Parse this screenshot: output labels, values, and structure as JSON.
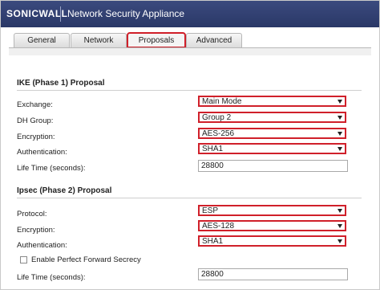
{
  "header": {
    "logo": "SONICWALL",
    "product": "Network Security Appliance"
  },
  "tabs": [
    {
      "label": "General",
      "active": false
    },
    {
      "label": "Network",
      "active": false
    },
    {
      "label": "Proposals",
      "active": true
    },
    {
      "label": "Advanced",
      "active": false
    }
  ],
  "ike": {
    "title": "IKE (Phase 1) Proposal",
    "exchange": {
      "label": "Exchange:",
      "value": "Main Mode"
    },
    "dh_group": {
      "label": "DH Group:",
      "value": "Group 2"
    },
    "encryption": {
      "label": "Encryption:",
      "value": "AES-256"
    },
    "authentication": {
      "label": "Authentication:",
      "value": "SHA1"
    },
    "lifetime": {
      "label": "Life Time (seconds):",
      "value": "28800"
    }
  },
  "ipsec": {
    "title": "Ipsec (Phase 2) Proposal",
    "protocol": {
      "label": "Protocol:",
      "value": "ESP"
    },
    "encryption": {
      "label": "Encryption:",
      "value": "AES-128"
    },
    "authentication": {
      "label": "Authentication:",
      "value": "SHA1"
    },
    "pfs": {
      "label": "Enable Perfect Forward Secrecy",
      "checked": false
    },
    "lifetime": {
      "label": "Life Time (seconds):",
      "value": "28800"
    }
  },
  "colors": {
    "header": "#2f3d70",
    "highlight": "#d0202a"
  }
}
